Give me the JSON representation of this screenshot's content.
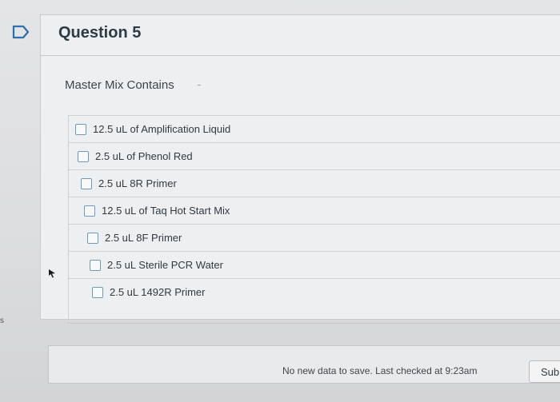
{
  "question": {
    "title": "Question 5",
    "prompt": "Master Mix Contains",
    "answers": [
      {
        "label": "12.5 uL of Amplification Liquid"
      },
      {
        "label": "2.5 uL of Phenol Red"
      },
      {
        "label": "2.5 uL 8R Primer"
      },
      {
        "label": "12.5 uL of Taq Hot Start Mix"
      },
      {
        "label": "2.5 uL 8F Primer"
      },
      {
        "label": "2.5 uL Sterile PCR Water"
      },
      {
        "label": "2.5 uL 1492R Primer"
      }
    ]
  },
  "footer": {
    "status": "No new data to save. Last checked at 9:23am",
    "submit_label": "Sub"
  },
  "edge": {
    "mark": "s"
  },
  "icons": {
    "flag": "flag-question-icon",
    "cursor": "mouse-pointer-icon"
  },
  "colors": {
    "checkbox_border": "#6a9bbf",
    "title_text": "#2d3b45"
  }
}
